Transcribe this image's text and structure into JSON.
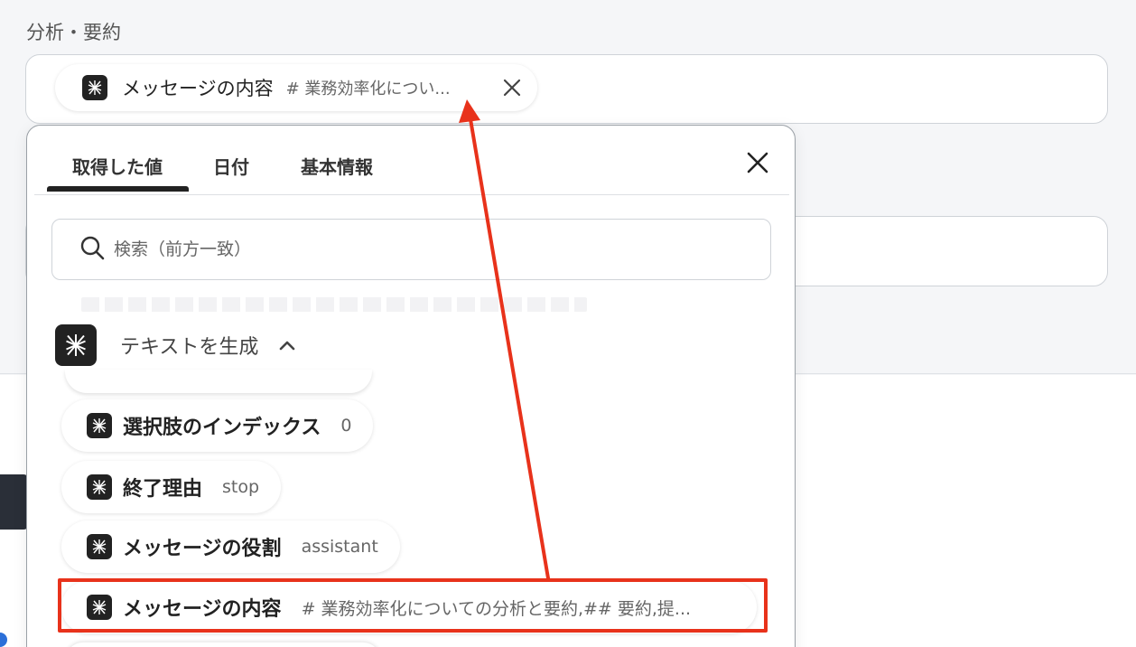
{
  "section": {
    "label": "分析・要約"
  },
  "field_chip": {
    "name": "メッセージの内容",
    "value": "# 業務効率化につい..."
  },
  "popover": {
    "tabs": [
      {
        "label": "取得した値",
        "active": true
      },
      {
        "label": "日付",
        "active": false
      },
      {
        "label": "基本情報",
        "active": false
      }
    ],
    "search": {
      "placeholder": "検索（前方一致）"
    },
    "group": {
      "label": "テキストを生成"
    },
    "items": [
      {
        "name": "選択肢のインデックス",
        "value": "0"
      },
      {
        "name": "終了理由",
        "value": "stop"
      },
      {
        "name": "メッセージの役割",
        "value": "assistant"
      },
      {
        "name": "メッセージの内容",
        "value": "# 業務効率化についての分析と要約,## 要約,提..."
      }
    ]
  },
  "colors": {
    "accent_highlight": "#e8321b",
    "chip_logo_bg": "#222222",
    "page_bg": "#f5f6f8"
  },
  "icons": {
    "chip_logo": "ai-model-logo-icon",
    "close": "close-icon",
    "search": "search-icon",
    "collapse": "chevron-up-icon"
  }
}
